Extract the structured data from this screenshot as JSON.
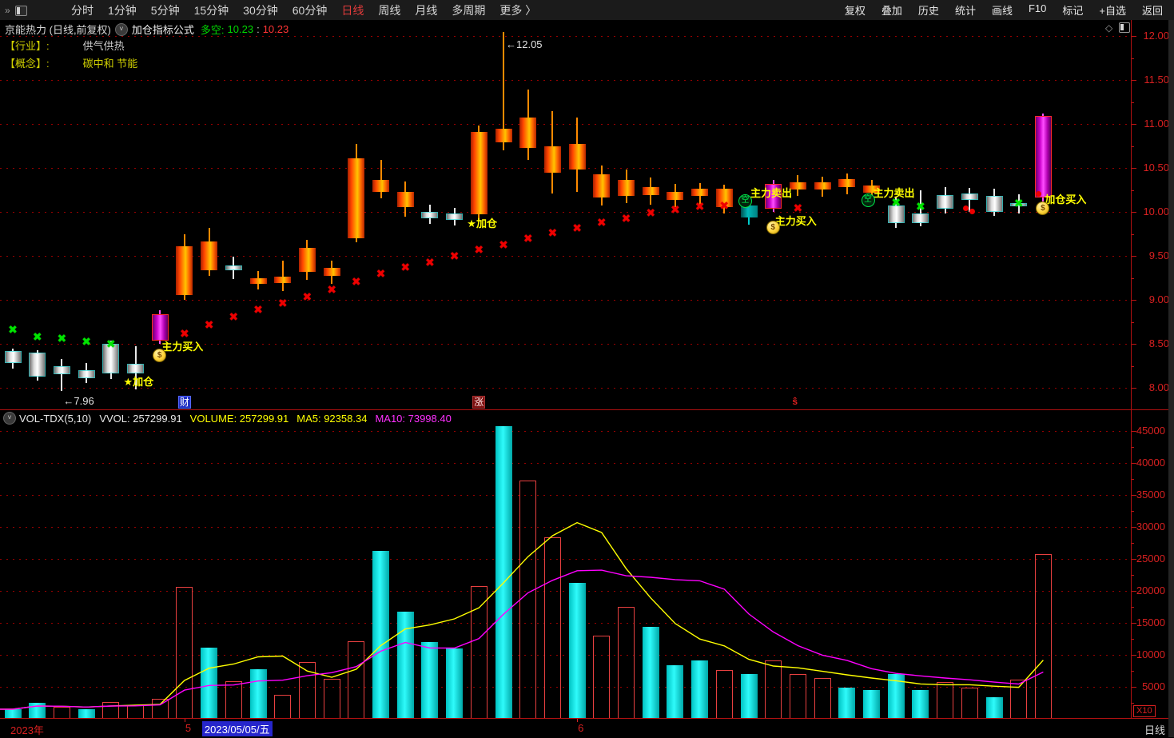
{
  "topbar": {
    "left_menu": [
      {
        "label": "分时",
        "active": false
      },
      {
        "label": "1分钟",
        "active": false
      },
      {
        "label": "5分钟",
        "active": false
      },
      {
        "label": "15分钟",
        "active": false
      },
      {
        "label": "30分钟",
        "active": false
      },
      {
        "label": "60分钟",
        "active": false
      },
      {
        "label": "日线",
        "active": true
      },
      {
        "label": "周线",
        "active": false
      },
      {
        "label": "月线",
        "active": false
      },
      {
        "label": "多周期",
        "active": false
      },
      {
        "label": "更多 〉",
        "active": false
      }
    ],
    "right_menu": [
      "复权",
      "叠加",
      "历史",
      "统计",
      "画线",
      "F10",
      "标记",
      "+自选",
      "返回"
    ]
  },
  "title_row": {
    "stock": "京能热力 (日线,前复权)",
    "formula": "加仓指标公式",
    "duokong_label": "多空:",
    "bull_value": "10.23",
    "colon": ":",
    "bear_value": "10.23"
  },
  "info_rows": {
    "industry_label": "【行业】:",
    "industry_value": "供气供热",
    "concept_label": "【概念】:",
    "concept_value": "碳中和 节能"
  },
  "price_axis": {
    "labels": [
      "12.00",
      "11.50",
      "11.00",
      "10.50",
      "10.00",
      "9.50",
      "9.00",
      "8.50",
      "8.00"
    ]
  },
  "volume_header": {
    "indicator": "VOL-TDX(5,10)",
    "vvol": "VVOL: 257299.91",
    "volume": "VOLUME: 257299.91",
    "ma5": "MA5: 92358.34",
    "ma10": "MA10: 73998.40"
  },
  "volume_axis": {
    "labels": [
      "45000",
      "40000",
      "35000",
      "30000",
      "25000",
      "20000",
      "15000",
      "10000",
      "5000"
    ],
    "unit_label": "X10"
  },
  "bottom_bar": {
    "year_label": "2023年",
    "month_ticks": [
      {
        "slot": 7,
        "label": "5"
      },
      {
        "slot": 23,
        "label": "6"
      }
    ],
    "selected_date": "2023/05/05/五",
    "period_label": "日线"
  },
  "colors": {
    "axis_red": "#d82020",
    "grid_red": "#9b0000",
    "vol_cyan": "#00e8e8",
    "vol_red_outline": "#e84040",
    "ma5_yellow": "#ffff00",
    "ma10_magenta": "#ff00ff",
    "signal_yellow": "#ffff00",
    "bull_green": "#00d800",
    "bear_red": "#ff3434",
    "selected_date_bg": "#2626cc"
  },
  "chart_data": {
    "type": "candlestick+volume",
    "title": "京能热力 日线 前复权",
    "price_range": [
      8.0,
      12.0
    ],
    "volume_range": [
      0,
      47500
    ],
    "volume_unit": "X10",
    "candle_columns": [
      "open",
      "close",
      "high",
      "low",
      "candle_style",
      "volume_x10",
      "volume_bar_style"
    ],
    "candles": [
      [
        8.42,
        8.3,
        8.45,
        8.22,
        "silver",
        1500,
        "cyan"
      ],
      [
        8.4,
        8.15,
        8.43,
        8.08,
        "silver",
        2500,
        "cyan"
      ],
      [
        8.25,
        8.17,
        8.33,
        7.96,
        "silver",
        1875,
        "red"
      ],
      [
        8.2,
        8.13,
        8.28,
        8.05,
        "silver",
        1500,
        "cyan"
      ],
      [
        8.5,
        8.18,
        8.54,
        8.1,
        "silver",
        2625,
        "red"
      ],
      [
        8.27,
        8.18,
        8.47,
        7.98,
        "silver",
        2125,
        "red"
      ],
      [
        8.55,
        8.84,
        8.88,
        8.5,
        "magenta",
        3125,
        "red"
      ],
      [
        9.05,
        9.61,
        9.75,
        9.0,
        "fire",
        20600,
        "red"
      ],
      [
        9.34,
        9.66,
        9.82,
        9.27,
        "fire",
        11100,
        "cyan"
      ],
      [
        9.39,
        9.35,
        9.49,
        9.24,
        "silver",
        5875,
        "red"
      ],
      [
        9.18,
        9.25,
        9.33,
        9.12,
        "fire",
        7750,
        "cyan"
      ],
      [
        9.19,
        9.26,
        9.45,
        9.1,
        "fire",
        3750,
        "red"
      ],
      [
        9.32,
        9.59,
        9.68,
        9.23,
        "fire",
        8875,
        "red"
      ],
      [
        9.27,
        9.36,
        9.45,
        9.18,
        "fire",
        6250,
        "red"
      ],
      [
        9.7,
        10.61,
        10.77,
        9.65,
        "fire",
        12125,
        "red"
      ],
      [
        10.23,
        10.36,
        10.59,
        10.15,
        "fire",
        26250,
        "cyan"
      ],
      [
        10.05,
        10.23,
        10.35,
        9.95,
        "fire",
        16750,
        "cyan"
      ],
      [
        10.0,
        9.95,
        10.08,
        9.86,
        "silver",
        12000,
        "cyan"
      ],
      [
        9.98,
        9.93,
        10.05,
        9.85,
        "silver",
        11000,
        "cyan"
      ],
      [
        9.97,
        10.91,
        10.98,
        9.9,
        "fire",
        20750,
        "red"
      ],
      [
        10.79,
        10.95,
        12.05,
        10.7,
        "fire",
        45750,
        "cyan"
      ],
      [
        10.73,
        11.07,
        11.39,
        10.59,
        "fire",
        37250,
        "red"
      ],
      [
        10.45,
        10.75,
        11.15,
        10.21,
        "fire",
        28400,
        "red"
      ],
      [
        10.48,
        10.77,
        11.07,
        10.23,
        "fire",
        21250,
        "cyan"
      ],
      [
        10.16,
        10.43,
        10.53,
        10.07,
        "fire",
        13000,
        "red"
      ],
      [
        10.18,
        10.36,
        10.48,
        10.1,
        "fire",
        17500,
        "red"
      ],
      [
        10.19,
        10.28,
        10.39,
        10.08,
        "fire",
        14375,
        "cyan"
      ],
      [
        10.14,
        10.23,
        10.32,
        10.05,
        "fire",
        8375,
        "cyan"
      ],
      [
        10.18,
        10.26,
        10.33,
        10.08,
        "fire",
        9125,
        "cyan"
      ],
      [
        10.05,
        10.26,
        10.31,
        9.98,
        "fire",
        7625,
        "red"
      ],
      [
        10.07,
        9.94,
        10.12,
        9.85,
        "teal",
        7000,
        "cyan"
      ],
      [
        10.05,
        10.32,
        10.36,
        10.0,
        "magenta",
        9125,
        "red"
      ],
      [
        10.25,
        10.34,
        10.42,
        10.18,
        "fire",
        7000,
        "red"
      ],
      [
        10.25,
        10.34,
        10.4,
        10.17,
        "fire",
        6375,
        "red"
      ],
      [
        10.28,
        10.37,
        10.44,
        10.2,
        "fire",
        4875,
        "cyan"
      ],
      [
        10.22,
        10.3,
        10.36,
        10.15,
        "fire",
        4500,
        "cyan"
      ],
      [
        10.07,
        9.89,
        10.16,
        9.82,
        "silver",
        7000,
        "cyan"
      ],
      [
        9.98,
        9.89,
        10.25,
        9.84,
        "silver",
        4500,
        "cyan"
      ],
      [
        10.19,
        10.05,
        10.28,
        9.98,
        "silver",
        5750,
        "red"
      ],
      [
        10.21,
        10.15,
        10.27,
        10.0,
        "silver",
        4875,
        "red"
      ],
      [
        10.18,
        10.02,
        10.26,
        9.95,
        "silver",
        3375,
        "cyan"
      ],
      [
        10.1,
        10.08,
        10.2,
        9.98,
        "silver",
        6125,
        "red"
      ],
      [
        10.18,
        11.09,
        11.12,
        10.12,
        "magenta",
        25730,
        "red"
      ]
    ],
    "ma_lines": [
      {
        "name": "MA5",
        "period": 5,
        "color": "#ffff00"
      },
      {
        "name": "MA10",
        "period": 10,
        "color": "#ff00ff"
      }
    ],
    "green_x": [
      {
        "i": 0,
        "p": 8.66
      },
      {
        "i": 1,
        "p": 8.58
      },
      {
        "i": 2,
        "p": 8.56
      },
      {
        "i": 3,
        "p": 8.53
      },
      {
        "i": 4,
        "p": 8.5
      },
      {
        "i": 36,
        "p": 10.11
      },
      {
        "i": 37,
        "p": 10.06
      },
      {
        "i": 41,
        "p": 10.1
      }
    ],
    "red_x": [
      {
        "i": 7,
        "p": 8.62
      },
      {
        "i": 8,
        "p": 8.72
      },
      {
        "i": 9,
        "p": 8.81
      },
      {
        "i": 10,
        "p": 8.89
      },
      {
        "i": 11,
        "p": 8.96
      },
      {
        "i": 12,
        "p": 9.04
      },
      {
        "i": 13,
        "p": 9.12
      },
      {
        "i": 14,
        "p": 9.21
      },
      {
        "i": 15,
        "p": 9.3
      },
      {
        "i": 16,
        "p": 9.37
      },
      {
        "i": 17,
        "p": 9.43
      },
      {
        "i": 18,
        "p": 9.5
      },
      {
        "i": 19,
        "p": 9.57
      },
      {
        "i": 20,
        "p": 9.63
      },
      {
        "i": 21,
        "p": 9.7
      },
      {
        "i": 22,
        "p": 9.76
      },
      {
        "i": 23,
        "p": 9.82
      },
      {
        "i": 24,
        "p": 9.88
      },
      {
        "i": 25,
        "p": 9.93
      },
      {
        "i": 26,
        "p": 9.99
      },
      {
        "i": 27,
        "p": 10.03
      },
      {
        "i": 28,
        "p": 10.06
      },
      {
        "i": 29,
        "p": 10.07
      },
      {
        "i": 32,
        "p": 10.05
      }
    ],
    "annotations": [
      {
        "i": 2,
        "type": "price-low-label",
        "text": "←7.96",
        "p": 7.92
      },
      {
        "i": 5,
        "type": "star-label",
        "text": "★加仓",
        "p": 8.16
      },
      {
        "i": 6,
        "type": "buy-label",
        "text": "主力买入",
        "p": 8.56
      },
      {
        "i": 6,
        "type": "coin-icon",
        "text": "$",
        "p": 8.45
      },
      {
        "i": 19,
        "type": "star-label",
        "text": "★加仓",
        "p": 9.96
      },
      {
        "i": 20,
        "type": "price-peak-label",
        "text": "←12.05",
        "p": 11.97
      },
      {
        "i": 30,
        "type": "sell-label",
        "text": "主力卖出",
        "p": 10.31
      },
      {
        "i": 30,
        "type": "kong-icon",
        "text": "空",
        "p": 10.2
      },
      {
        "i": 31,
        "type": "buy-label",
        "text": "主力买入",
        "p": 9.99
      },
      {
        "i": 31,
        "type": "coin-icon",
        "text": "$",
        "p": 9.9
      },
      {
        "i": 35,
        "type": "sell-label",
        "text": "主力卖出",
        "p": 10.31
      },
      {
        "i": 35,
        "type": "kong-icon",
        "text": "空",
        "p": 10.21
      },
      {
        "i": 39,
        "type": "red-dot-pair",
        "p": 10.07
      },
      {
        "i": 42,
        "type": "red-dot",
        "p": 10.24
      },
      {
        "i": 42,
        "type": "buy-label",
        "text": "加仓买入",
        "p": 10.24
      },
      {
        "i": 42,
        "type": "coin-icon",
        "text": "$",
        "p": 10.12
      }
    ],
    "axis_markers": [
      {
        "i": 7,
        "text": "财",
        "style": "blue"
      },
      {
        "i": 19,
        "text": "涨",
        "style": "redbox"
      },
      {
        "i": 32,
        "text": "ŝ",
        "style": "plain"
      }
    ]
  }
}
